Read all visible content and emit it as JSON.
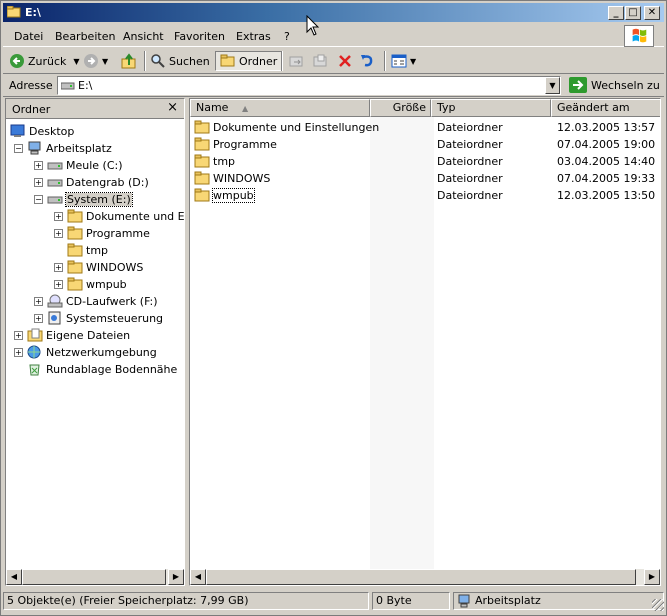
{
  "window": {
    "title": "E:\\"
  },
  "menu": [
    "Datei",
    "Bearbeiten",
    "Ansicht",
    "Favoriten",
    "Extras",
    "?"
  ],
  "toolbar": {
    "back": "Zurück",
    "search": "Suchen",
    "folders": "Ordner"
  },
  "address": {
    "label": "Adresse",
    "value": "E:\\",
    "go": "Wechseln zu"
  },
  "folder_pane": {
    "title": "Ordner",
    "tree": [
      {
        "label": "Desktop",
        "icon": "desktop-icon",
        "level": 0,
        "expander": ""
      },
      {
        "label": "Arbeitsplatz",
        "icon": "computer-icon",
        "level": 1,
        "expander": "−"
      },
      {
        "label": "Meule (C:)",
        "icon": "drive-icon",
        "level": 2,
        "expander": "+"
      },
      {
        "label": "Datengrab (D:)",
        "icon": "drive-icon",
        "level": 2,
        "expander": "+"
      },
      {
        "label": "System (E:)",
        "icon": "drive-icon",
        "level": 2,
        "expander": "−"
      },
      {
        "label": "Dokumente und Einstellungen",
        "icon": "folder-icon",
        "level": 3,
        "expander": "+"
      },
      {
        "label": "Programme",
        "icon": "folder-icon",
        "level": 3,
        "expander": "+"
      },
      {
        "label": "tmp",
        "icon": "folder-icon",
        "level": 3,
        "expander": ""
      },
      {
        "label": "WINDOWS",
        "icon": "folder-icon",
        "level": 3,
        "expander": "+"
      },
      {
        "label": "wmpub",
        "icon": "folder-icon",
        "level": 3,
        "expander": "+"
      },
      {
        "label": "CD-Laufwerk (F:)",
        "icon": "cd-drive-icon",
        "level": 2,
        "expander": "+"
      },
      {
        "label": "Systemsteuerung",
        "icon": "control-panel-icon",
        "level": 2,
        "expander": "+"
      },
      {
        "label": "Eigene Dateien",
        "icon": "documents-icon",
        "level": 1,
        "expander": "+"
      },
      {
        "label": "Netzwerkumgebung",
        "icon": "network-icon",
        "level": 1,
        "expander": "+"
      },
      {
        "label": "Rundablage Bodennähe",
        "icon": "recycle-bin-icon",
        "level": 1,
        "expander": ""
      }
    ]
  },
  "list": {
    "columns": {
      "name": "Name",
      "size": "Größe",
      "type": "Typ",
      "modified": "Geändert am"
    },
    "rows": [
      {
        "name": "Dokumente und Einstellungen",
        "type": "Dateiordner",
        "modified": "12.03.2005 13:57"
      },
      {
        "name": "Programme",
        "type": "Dateiordner",
        "modified": "07.04.2005 19:00"
      },
      {
        "name": "tmp",
        "type": "Dateiordner",
        "modified": "03.04.2005 14:40"
      },
      {
        "name": "WINDOWS",
        "type": "Dateiordner",
        "modified": "07.04.2005 19:33"
      },
      {
        "name": "wmpub",
        "type": "Dateiordner",
        "modified": "12.03.2005 13:50"
      }
    ]
  },
  "status": {
    "objects": "5 Objekte(e) (Freier Speicherplatz: 7,99 GB)",
    "size": "0 Byte",
    "zone": "Arbeitsplatz"
  }
}
